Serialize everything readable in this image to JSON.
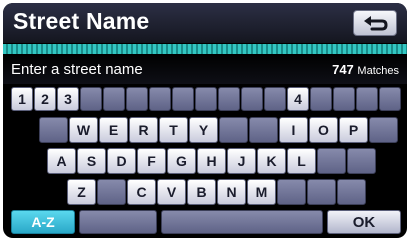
{
  "header": {
    "title": "Street Name"
  },
  "entry": {
    "prompt": "Enter a street name",
    "match_count": "747",
    "match_unit": "Matches"
  },
  "keyboard": {
    "row1": [
      "1",
      "2",
      "3",
      "",
      "",
      "",
      "",
      "",
      "",
      "",
      "",
      "",
      "4",
      "",
      "",
      "",
      ""
    ],
    "row2": [
      "",
      "W",
      "E",
      "R",
      "T",
      "Y",
      "",
      "",
      "I",
      "O",
      "P",
      ""
    ],
    "row3": [
      "A",
      "S",
      "D",
      "F",
      "G",
      "H",
      "J",
      "K",
      "L",
      "",
      ""
    ],
    "row4": [
      "Z",
      "",
      "C",
      "V",
      "B",
      "N",
      "M",
      "",
      "",
      ""
    ],
    "mode_label": "A-Z",
    "ok_label": "OK"
  },
  "colors": {
    "accent": "#32c7c2",
    "key": "#7377a0",
    "mode_key": "#2aa8c8"
  }
}
